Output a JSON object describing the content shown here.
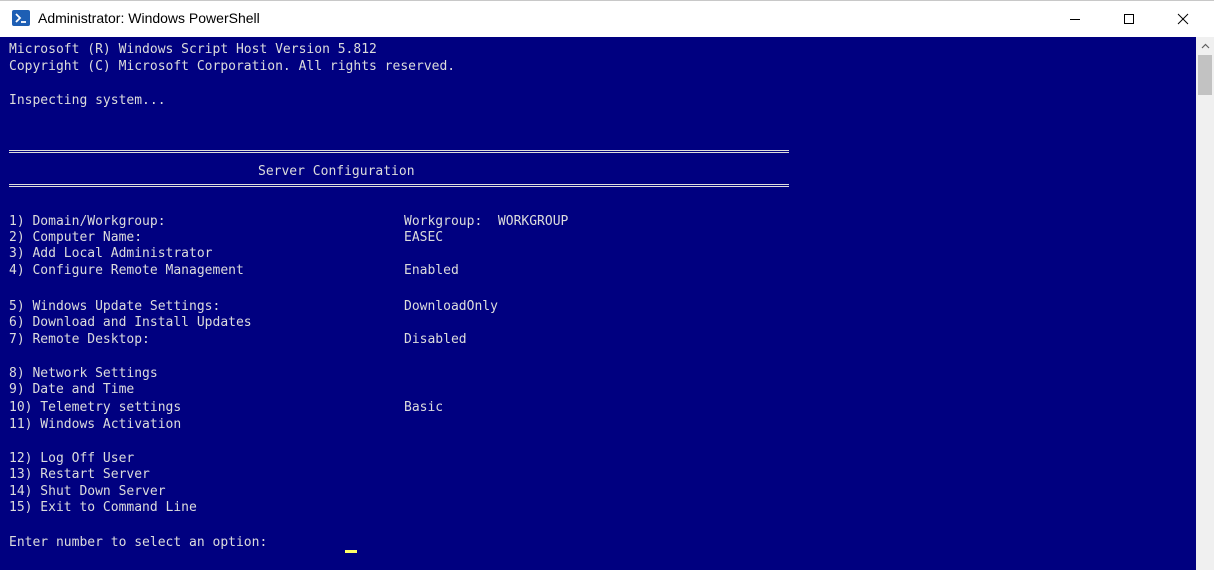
{
  "window": {
    "title": "Administrator: Windows PowerShell"
  },
  "console": {
    "header_lines": [
      "Microsoft (R) Windows Script Host Version 5.812",
      "Copyright (C) Microsoft Corporation. All rights reserved.",
      "Inspecting system..."
    ],
    "section_title": "Server Configuration",
    "menu": [
      {
        "label": "1) Domain/Workgroup:",
        "value": "Workgroup:  WORKGROUP"
      },
      {
        "label": "2) Computer Name:",
        "value": "EASEC"
      },
      {
        "label": "3) Add Local Administrator",
        "value": ""
      },
      {
        "label": "4) Configure Remote Management",
        "value": "Enabled"
      },
      {
        "label": "5) Windows Update Settings:",
        "value": "DownloadOnly"
      },
      {
        "label": "6) Download and Install Updates",
        "value": ""
      },
      {
        "label": "7) Remote Desktop:",
        "value": "Disabled"
      },
      {
        "label": "8) Network Settings",
        "value": ""
      },
      {
        "label": "9) Date and Time",
        "value": ""
      },
      {
        "label": "10) Telemetry settings",
        "value": "Basic"
      },
      {
        "label": "11) Windows Activation",
        "value": ""
      },
      {
        "label": "12) Log Off User",
        "value": ""
      },
      {
        "label": "13) Restart Server",
        "value": ""
      },
      {
        "label": "14) Shut Down Server",
        "value": ""
      },
      {
        "label": "15) Exit to Command Line",
        "value": ""
      }
    ],
    "prompt": "Enter number to select an option: "
  },
  "colors": {
    "console_background": "#000080",
    "console_text": "#dcdcdc",
    "cursor": "#ffff66"
  },
  "icons": [
    "powershell-icon",
    "minimize-icon",
    "maximize-icon",
    "close-icon",
    "scroll-up-icon"
  ]
}
